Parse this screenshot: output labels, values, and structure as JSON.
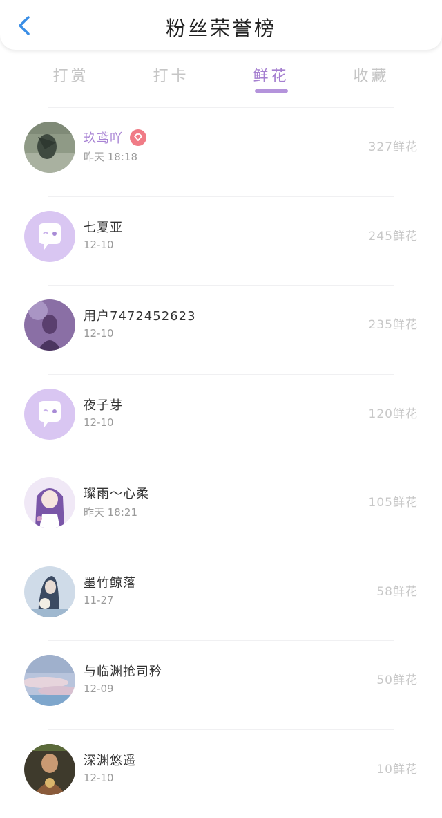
{
  "header": {
    "title": "粉丝荣誉榜"
  },
  "tabs": [
    {
      "label": "打赏"
    },
    {
      "label": "打卡"
    },
    {
      "label": "鲜花"
    },
    {
      "label": "收藏"
    }
  ],
  "active_tab_index": 2,
  "colors": {
    "accent": "#a57fd0",
    "back_icon": "#3a8ee6",
    "badge": "#f07b86"
  },
  "fans": [
    {
      "name": "玖鸢吖",
      "date": "昨天 18:18",
      "count": "327鲜花",
      "vip": true,
      "avatar": "bird-photo"
    },
    {
      "name": "七夏亚",
      "date": "12-10",
      "count": "245鲜花",
      "vip": false,
      "avatar": "default-chat-avatar"
    },
    {
      "name": "用户7472452623",
      "date": "12-10",
      "count": "235鲜花",
      "vip": false,
      "avatar": "purple-portrait"
    },
    {
      "name": "夜子芽",
      "date": "12-10",
      "count": "120鲜花",
      "vip": false,
      "avatar": "default-chat-avatar"
    },
    {
      "name": "璨雨～心柔",
      "date": "昨天 18:21",
      "count": "105鲜花",
      "vip": false,
      "avatar": "anime-girl"
    },
    {
      "name": "墨竹鲸落",
      "date": "11-27",
      "count": "58鲜花",
      "vip": false,
      "avatar": "blue-figure"
    },
    {
      "name": "与临渊抢司矜",
      "date": "12-09",
      "count": "50鲜花",
      "vip": false,
      "avatar": "sky-clouds"
    },
    {
      "name": "深渊悠遥",
      "date": "12-10",
      "count": "10鲜花",
      "vip": false,
      "avatar": "ornate-portrait"
    }
  ]
}
